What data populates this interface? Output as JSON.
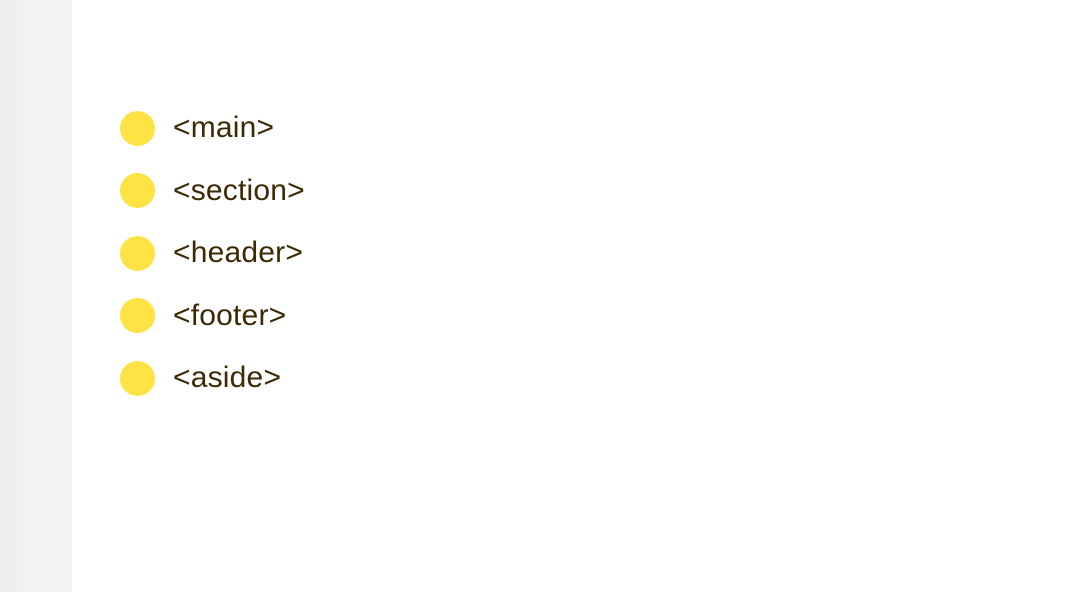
{
  "colors": {
    "bullet": "#ffe243",
    "text": "#3b2a04",
    "sidebar": "#f2f2f2",
    "background": "#ffffff"
  },
  "tags": {
    "items": [
      {
        "label": "<main>"
      },
      {
        "label": "<section>"
      },
      {
        "label": "<header>"
      },
      {
        "label": "<footer>"
      },
      {
        "label": "<aside>"
      }
    ]
  }
}
